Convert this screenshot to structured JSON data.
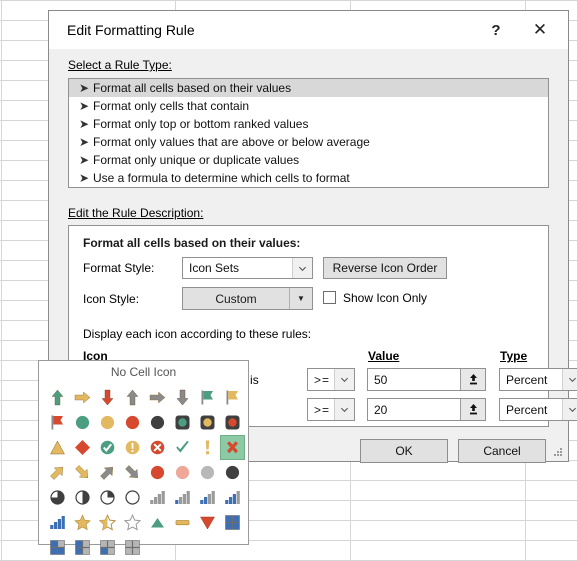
{
  "window": {
    "title": "Edit Formatting Rule",
    "help_label": "?",
    "close_label": "✕"
  },
  "rule_type": {
    "section_label": "Select a Rule Type:",
    "selected_index": 0,
    "items": [
      "Format all cells based on their values",
      "Format only cells that contain",
      "Format only top or bottom ranked values",
      "Format only values that are above or below average",
      "Format only unique or duplicate values",
      "Use a formula to determine which cells to format"
    ]
  },
  "description": {
    "section_label": "Edit the Rule Description:",
    "heading": "Format all cells based on their values:",
    "format_style_label": "Format Style:",
    "format_style_value": "Icon Sets",
    "reverse_button": "Reverse Icon Order",
    "icon_style_label": "Icon Style:",
    "icon_style_value": "Custom",
    "show_icon_only_label": "Show Icon Only",
    "show_icon_only_checked": false,
    "display_rules_label": "Display each icon according to these rules:",
    "col_icon": "Icon",
    "col_value": "Value",
    "col_type": "Type",
    "when_value_is": "when value is",
    "rows": [
      {
        "operator": ">=",
        "value": "50",
        "type": "Percent"
      },
      {
        "operator": ">=",
        "value": "20",
        "type": "Percent"
      }
    ]
  },
  "icon_popup": {
    "header": "No Cell Icon",
    "selected_index": 23,
    "icons": [
      "arrow-up-green",
      "arrow-side-up-yellow",
      "arrow-down-red",
      "arrow-up-gray",
      "arrow-side-up-gray",
      "arrow-down-gray",
      "flag-green",
      "flag-yellow",
      "flag-red",
      "circle-green",
      "circle-yellow",
      "circle-red",
      "circle-black",
      "traffic-green",
      "traffic-yellow",
      "traffic-red",
      "triangle-yellow",
      "diamond-red",
      "check-circle-green",
      "exclam-circle-yellow",
      "x-circle-red",
      "check-mark-green",
      "exclam-mark-yellow",
      "x-mark-red",
      "arrow-ne-yellow",
      "arrow-se-yellow",
      "arrow-ne-gray",
      "arrow-se-gray",
      "circle-red-solid",
      "circle-pink",
      "circle-silver",
      "circle-dark",
      "pie-quarter",
      "pie-half",
      "pie-three-quarter",
      "pie-empty",
      "bars-1-gray",
      "bars-2-blue",
      "bars-3-blue",
      "bars-4-blue",
      "bars-full-blue",
      "star-full-gold",
      "star-half-gold",
      "star-empty",
      "triangle-up-green",
      "dash-yellow",
      "triangle-down-red",
      "quad-4-blue",
      "quad-3-blue",
      "quad-2-blue",
      "quad-1-blue",
      "quad-0-gray"
    ]
  },
  "footer": {
    "ok_label": "OK",
    "cancel_label": "Cancel"
  },
  "colors": {
    "green": "#4c9e81",
    "yellow": "#e2b860",
    "red": "#d6492f",
    "gray": "#8a8a8a",
    "dark": "#404040",
    "blue": "#3d6fb4",
    "highlight": "#8ec9a5"
  }
}
